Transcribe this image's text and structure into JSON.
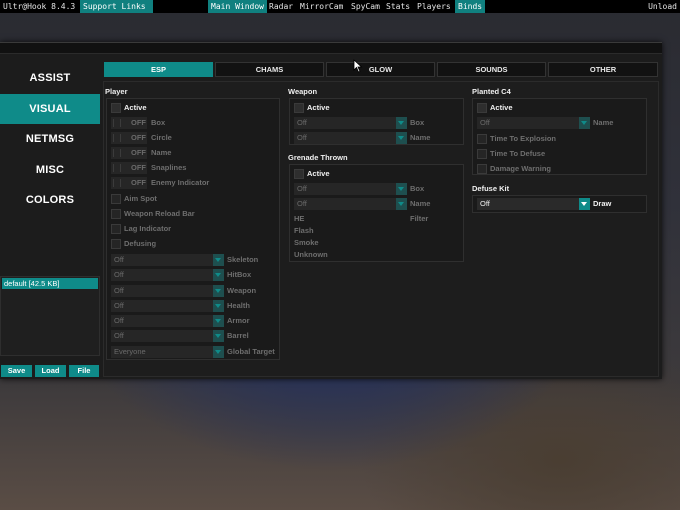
{
  "topbar": {
    "app_title": "Ultr@Hook 8.4.3",
    "support_links": "Support Links",
    "menu": [
      "Main Window",
      "Radar",
      "MirrorCam",
      "SpyCam",
      "Stats",
      "Players",
      "Binds"
    ],
    "unload": "Unload"
  },
  "sidebar": {
    "items": [
      "ASSIST",
      "VISUAL",
      "NETMSG",
      "MISC",
      "COLORS"
    ],
    "active": "VISUAL",
    "config_item": "default [42.5 KB]",
    "buttons": {
      "save": "Save",
      "load": "Load",
      "file": "File"
    }
  },
  "tabs": [
    "ESP",
    "CHAMS",
    "GLOW",
    "SOUNDS",
    "OTHER"
  ],
  "active_tab": "ESP",
  "player": {
    "title": "Player",
    "active": "Active",
    "toggles": [
      {
        "state": "OFF",
        "label": "Box"
      },
      {
        "state": "OFF",
        "label": "Circle"
      },
      {
        "state": "OFF",
        "label": "Name"
      },
      {
        "state": "OFF",
        "label": "Snaplines"
      },
      {
        "state": "OFF",
        "label": "Enemy Indicator"
      }
    ],
    "checks": [
      "Aim Spot",
      "Weapon Reload Bar",
      "Lag Indicator",
      "Defusing"
    ],
    "dropdowns": [
      {
        "value": "Off",
        "label": "Skeleton"
      },
      {
        "value": "Off",
        "label": "HitBox"
      },
      {
        "value": "Off",
        "label": "Weapon"
      },
      {
        "value": "Off",
        "label": "Health"
      },
      {
        "value": "Off",
        "label": "Armor"
      },
      {
        "value": "Off",
        "label": "Barrel"
      },
      {
        "value": "Everyone",
        "label": "Global Target"
      }
    ]
  },
  "weapon": {
    "title": "Weapon",
    "active": "Active",
    "dropdowns": [
      {
        "value": "Off",
        "label": "Box"
      },
      {
        "value": "Off",
        "label": "Name"
      }
    ]
  },
  "grenade": {
    "title": "Grenade Thrown",
    "active": "Active",
    "dropdowns": [
      {
        "value": "Off",
        "label": "Box"
      },
      {
        "value": "Off",
        "label": "Name"
      }
    ],
    "filter_label": "Filter",
    "filter_items": [
      "HE",
      "Flash",
      "Smoke",
      "Unknown"
    ]
  },
  "planted_c4": {
    "title": "Planted C4",
    "active": "Active",
    "dropdown": {
      "value": "Off",
      "label": "Name"
    },
    "checks": [
      "Time To Explosion",
      "Time To Defuse",
      "Damage Warning"
    ]
  },
  "defuse_kit": {
    "title": "Defuse Kit",
    "dropdown": {
      "value": "Off",
      "label": "Draw"
    }
  },
  "colors": {
    "accent": "#0f8b89",
    "panel": "#1c1c1c",
    "topbar": "#000000"
  }
}
